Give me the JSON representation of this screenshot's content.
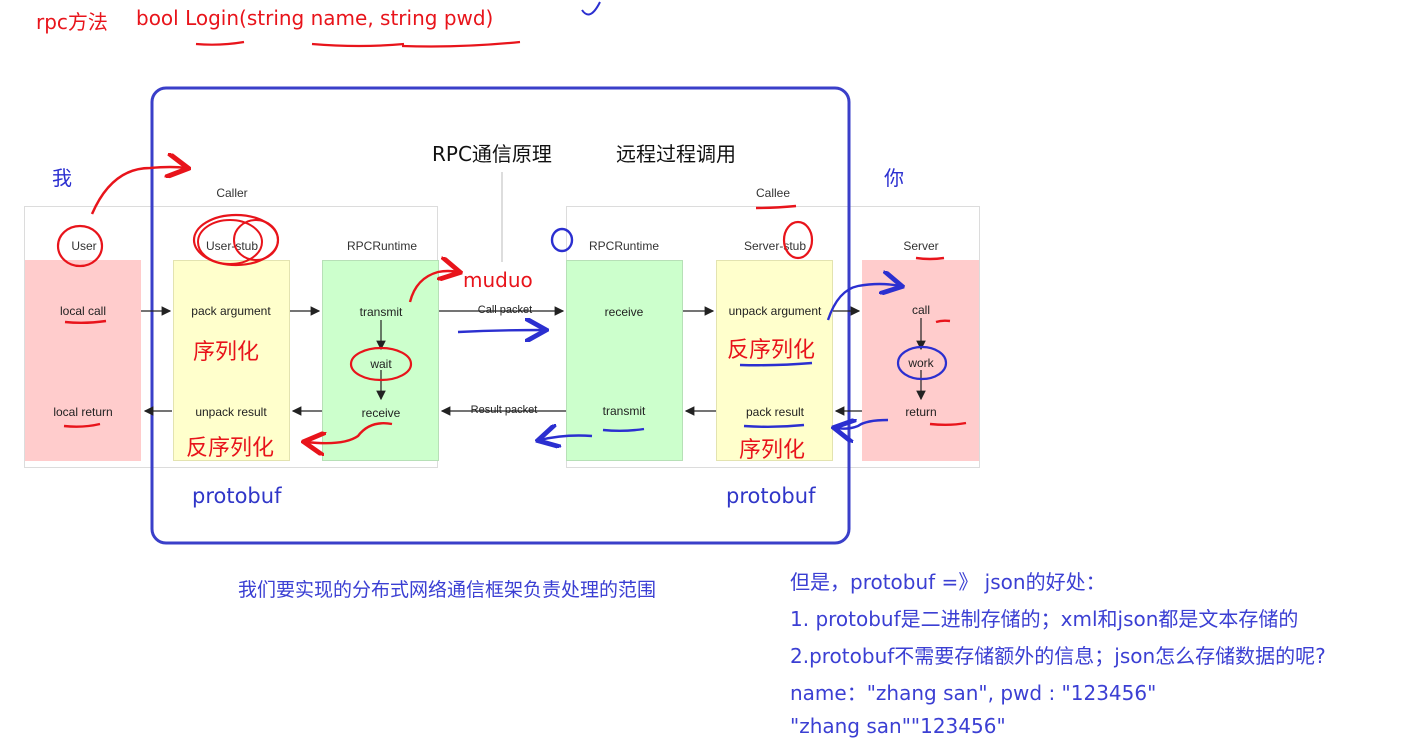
{
  "header": {
    "rpc_label": "rpc方法",
    "signature": "bool Login(string name, string pwd)"
  },
  "diagram": {
    "title": "RPC通信原理",
    "subtitle": "远程过程调用",
    "me_label": "我",
    "you_label": "你",
    "caller_label": "Caller",
    "callee_label": "Callee",
    "columns": {
      "user": "User",
      "user_stub": "User-stub",
      "rpc_runtime_left": "RPCRuntime",
      "rpc_runtime_right": "RPCRuntime",
      "server_stub": "Server-stub",
      "server": "Server"
    },
    "user_cells": {
      "call": "local call",
      "return": "local return"
    },
    "user_stub_cells": {
      "pack": "pack argument",
      "unpack": "unpack result"
    },
    "runtime_left_cells": {
      "transmit": "transmit",
      "wait": "wait",
      "receive": "receive"
    },
    "runtime_right_cells": {
      "receive": "receive",
      "transmit": "transmit"
    },
    "server_stub_cells": {
      "unpack": "unpack argument",
      "pack": "pack result"
    },
    "server_cells": {
      "call": "call",
      "work": "work",
      "return": "return"
    },
    "call_packet": "Call packet",
    "result_packet": "Result packet",
    "muduo": "muduo",
    "serialize_left": "序列化",
    "deserialize_left": "反序列化",
    "deserialize_right": "反序列化",
    "serialize_right": "序列化",
    "protobuf_left": "protobuf",
    "protobuf_right": "protobuf"
  },
  "caption": "我们要实现的分布式网络通信框架负责处理的范围",
  "notes": {
    "line1": "但是，protobuf =》 json的好处：",
    "line2": "1. protobuf是二进制存储的；xml和json都是文本存储的",
    "line3": "2.protobuf不需要存储额外的信息；json怎么存储数据的呢?",
    "line4": " name：\"zhang san\", pwd : \"123456\"",
    "line5": "\"zhang san\"\"123456\""
  },
  "colors": {
    "pen_red": "#e8141b",
    "pen_blue": "#2b2fd0",
    "user_fill": "#ffcccc",
    "stub_fill": "#ffffcc",
    "runtime_fill": "#ccffcc"
  }
}
